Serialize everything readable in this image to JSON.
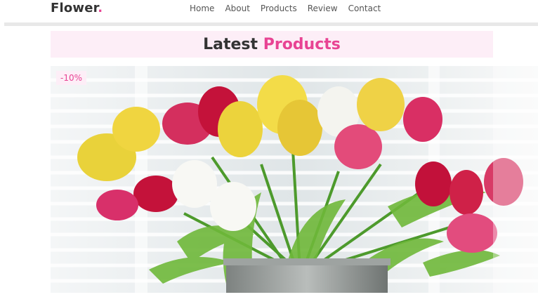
{
  "header": {
    "logo_text": "Flower",
    "logo_dot": ".",
    "nav": [
      {
        "label": "Home"
      },
      {
        "label": "About"
      },
      {
        "label": "Products"
      },
      {
        "label": "Review"
      },
      {
        "label": "Contact"
      }
    ]
  },
  "section": {
    "heading_main": "Latest",
    "heading_accent": "Products"
  },
  "product": {
    "discount_badge": "-10%",
    "image_icon": "tulip-bouquet-photo"
  },
  "colors": {
    "accent": "#e84393",
    "accent_bg": "#fdeef7",
    "text_dark": "#333333"
  }
}
